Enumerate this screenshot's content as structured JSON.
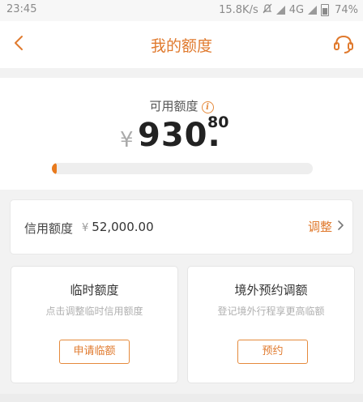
{
  "status_bar": {
    "time": "23:45",
    "net_speed": "15.8K/s",
    "network": "4G",
    "battery": "74%"
  },
  "nav": {
    "title": "我的额度",
    "back_icon": "chevron-left-icon",
    "service_icon": "headset-icon"
  },
  "summary": {
    "available_label": "可用额度",
    "info_icon": "info-icon",
    "currency": "¥",
    "amount_int": "930.",
    "amount_dec": "80",
    "usage_fraction": 0.018
  },
  "credit": {
    "label": "信用额度",
    "currency": "¥",
    "value": "52,000.00",
    "adjust_label": "调整"
  },
  "tiles": [
    {
      "title": "临时额度",
      "subtitle": "点击调整临时信用额度",
      "button": "申请临额"
    },
    {
      "title": "境外预约调额",
      "subtitle": "登记境外行程享更高临额",
      "button": "预约"
    }
  ],
  "colors": {
    "accent": "#e07a2e",
    "progress": "#e87a1e",
    "background": "#f2f2f2"
  }
}
